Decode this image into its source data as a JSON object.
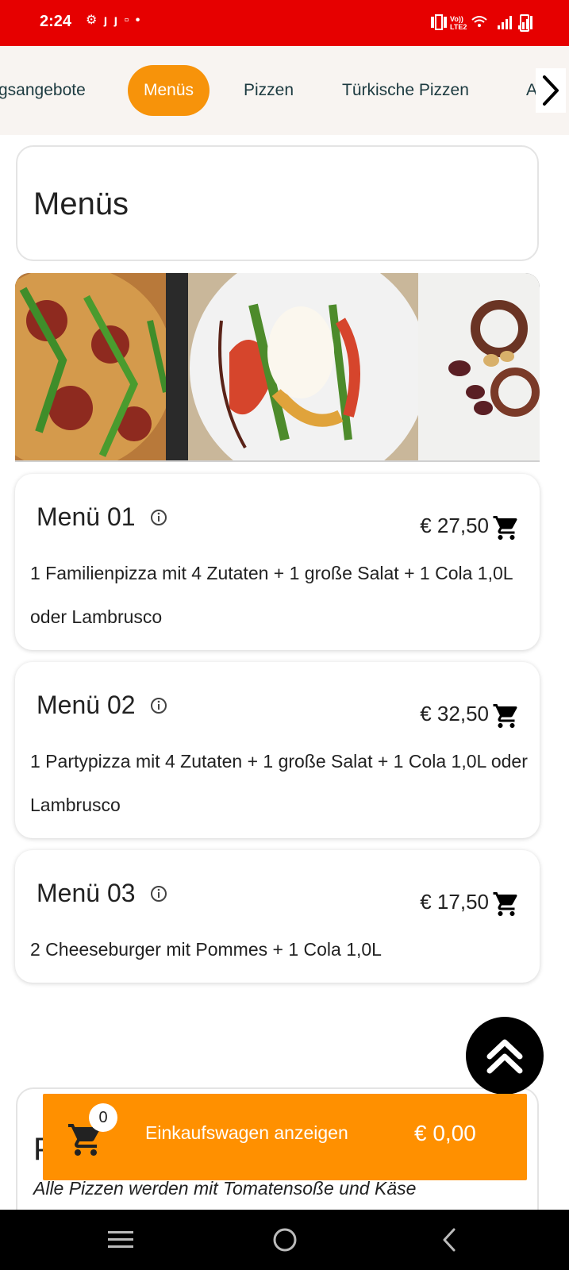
{
  "status_bar": {
    "time": "2:24",
    "left_icons": "⚙ ȷ ȷ ▫ •",
    "right_icons": "Vo LTE2"
  },
  "categories": {
    "items": [
      {
        "label": "gsangebote",
        "active": false
      },
      {
        "label": "Menüs",
        "active": true
      },
      {
        "label": "Pizzen",
        "active": false
      },
      {
        "label": "Türkische Pizzen",
        "active": false
      },
      {
        "label": "A",
        "active": false
      }
    ],
    "next_icon": "chevron-right-icon"
  },
  "section": {
    "title": "Menüs"
  },
  "menu_items": [
    {
      "name": "Menü 01",
      "price": "€ 27,50",
      "description": "1 Familienpizza mit 4 Zutaten + 1 große Salat + 1 Cola 1,0L oder Lambrusco"
    },
    {
      "name": "Menü 02",
      "price": "€ 32,50",
      "description": "1 Partypizza mit 4 Zutaten + 1 große Salat + 1 Cola 1,0L oder Lambrusco"
    },
    {
      "name": "Menü 03",
      "price": "€ 17,50",
      "description": "2 Cheeseburger mit Pommes + 1 Cola 1,0L"
    }
  ],
  "next_section": {
    "title_letter": "P",
    "subtitle": "Alle Pizzen werden mit Tomatensoße und Käse"
  },
  "cart": {
    "count": "0",
    "label": "Einkaufswagen anzeigen",
    "total": "€ 0,00"
  },
  "colors": {
    "status_bar": "#e60000",
    "accent": "#f7930a",
    "cart_bar": "#ff9000"
  }
}
